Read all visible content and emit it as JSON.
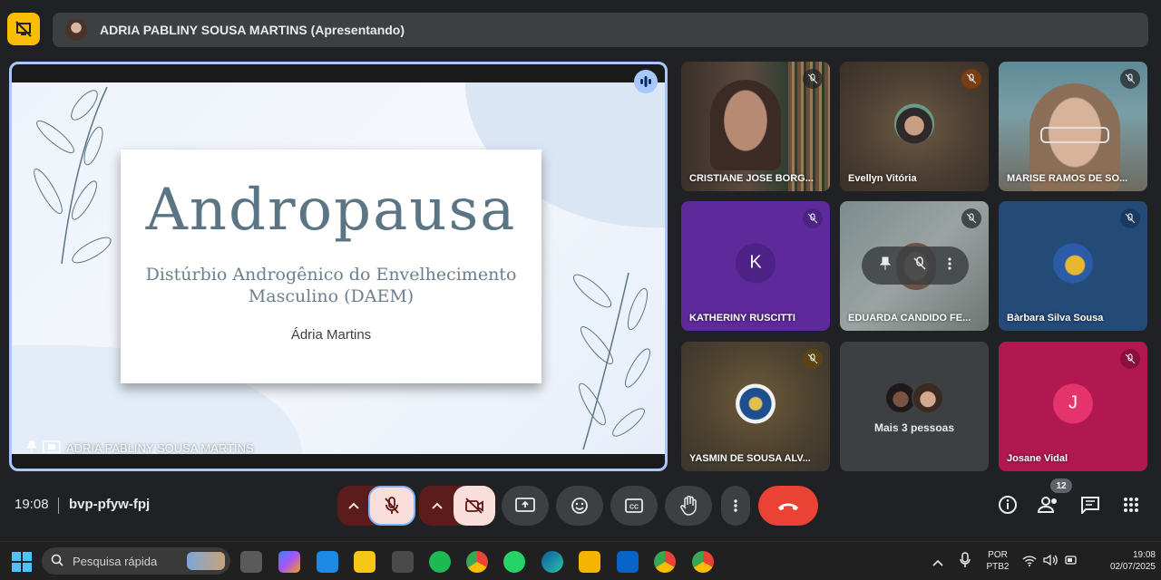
{
  "header": {
    "presenter_label": "ADRIA PABLINY SOUSA MARTINS (Apresentando)"
  },
  "slide": {
    "title": "Andropausa",
    "subtitle_line1": "Distúrbio Androgênico do Envelhecimento",
    "subtitle_line2": "Masculino (DAEM)",
    "author": "Ádria Martins"
  },
  "stage": {
    "presenter_name": "ADRIA PABLINY SOUSA MARTINS"
  },
  "participants": [
    {
      "name": "CRISTIANE JOSE BORG...",
      "type": "video"
    },
    {
      "name": "Evellyn Vitória",
      "type": "photo"
    },
    {
      "name": "MARISE RAMOS DE SO...",
      "type": "video"
    },
    {
      "name": "KATHERINY RUSCITTI",
      "type": "initial",
      "initial": "K"
    },
    {
      "name": "EDUARDA CANDIDO FE...",
      "type": "video"
    },
    {
      "name": "Bàrbara Silva Sousa",
      "type": "photo"
    },
    {
      "name": "YASMIN DE SOUSA ALV...",
      "type": "photo"
    },
    {
      "name": "",
      "type": "more",
      "label": "Mais 3 pessoas"
    },
    {
      "name": "Josane Vidal",
      "type": "initial",
      "initial": "J"
    }
  ],
  "meeting": {
    "time": "19:08",
    "code": "bvp-pfyw-fpj",
    "participant_count": "12"
  },
  "taskbar": {
    "search_placeholder": "Pesquisa rápida",
    "lang_line1": "POR",
    "lang_line2": "PTB2",
    "time": "19:08",
    "date": "02/07/2025"
  },
  "colors": {
    "accent_blue": "#a8c7fa",
    "end_call": "#ea4335",
    "mute_active": "#f9dedc"
  }
}
